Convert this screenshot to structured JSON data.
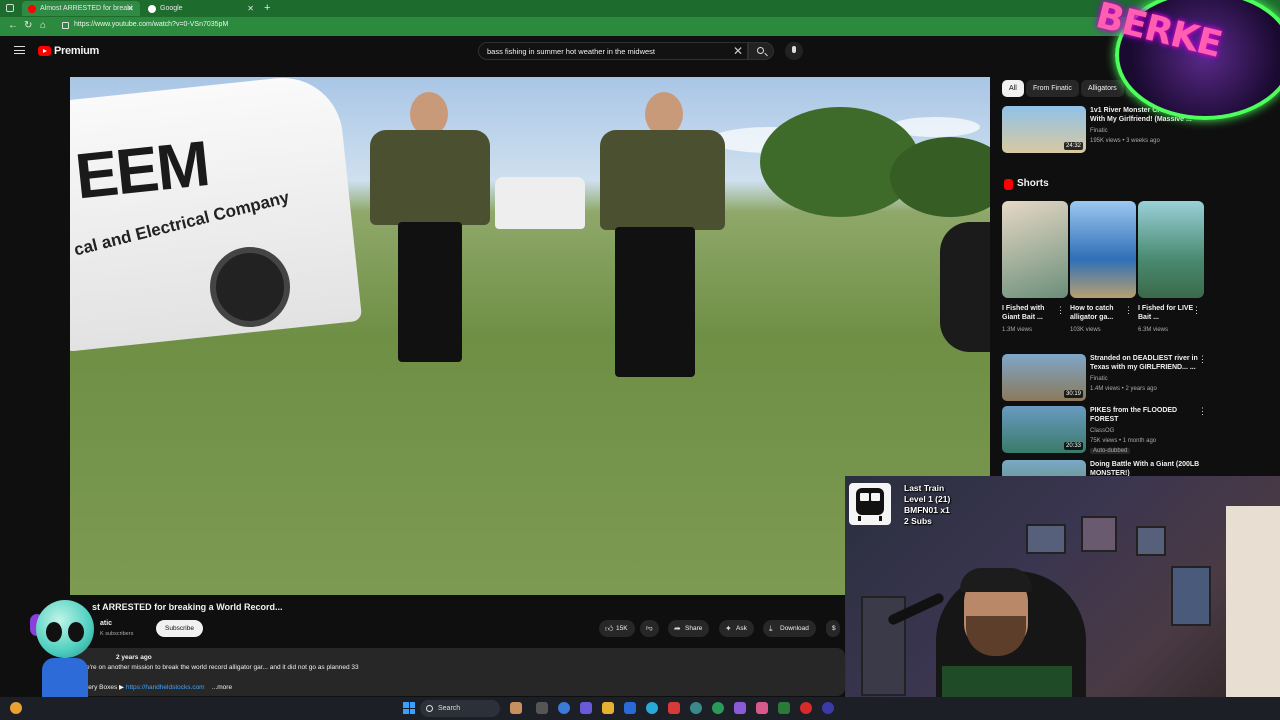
{
  "browser": {
    "tabs": [
      {
        "label": "Almost ARRESTED for breaki",
        "active": true
      },
      {
        "label": "Google",
        "active": false
      }
    ],
    "url": "https://www.youtube.com/watch?v=0-VSn7035pM"
  },
  "header": {
    "brand": "Premium",
    "search_value": "bass fishing in summer hot weather in the midwest"
  },
  "video": {
    "van_logo": "EEM",
    "van_sub": "cal and Electrical Company",
    "title": "st ARRESTED for breaking a World Record...",
    "channel": "atic",
    "subs": "K subscribers",
    "subscribe": "Subscribe",
    "actions": {
      "like": "15K",
      "share": "Share",
      "ask": "Ask",
      "download": "Download"
    },
    "description": {
      "meta": "2 years ago",
      "line": "We're on another mission to break the world record alligator gar... and it did not go as planned 33",
      "links_prefix": "ystery Boxes ▶",
      "link": "https://handheldstocks.com",
      "more": "...more"
    }
  },
  "sidebar": {
    "chips": [
      "All",
      "From Finatic",
      "Alligators",
      "Rece"
    ],
    "top_rec": {
      "title": "1v1 River Monster CHALLENGE With My Girlfriend! (Massive ...",
      "channel": "Finatic",
      "meta": "195K views • 3 weeks ago",
      "duration": "24:32"
    },
    "shorts_label": "Shorts",
    "shorts": [
      {
        "title": "I Fished with Giant Bait ...",
        "views": "1.3M views"
      },
      {
        "title": "How to catch alligator ga...",
        "views": "103K views"
      },
      {
        "title": "I Fished for LIVE Bait ...",
        "views": "6.3M views"
      }
    ],
    "recs": [
      {
        "title": "Stranded on DEADLIEST river in Texas with my GIRLFRIEND... ...",
        "channel": "Finatic",
        "meta": "1.4M views • 2 years ago",
        "duration": "30:19"
      },
      {
        "title": "PIKES from the FLOODED FOREST",
        "channel": "ClassOG",
        "meta": "75K views • 1 month ago",
        "badge": "Auto-dubbed",
        "duration": "20:33"
      },
      {
        "title": "Doing Battle With a Giant (200LB MONSTER!)",
        "channel": "",
        "meta": "",
        "duration": ""
      }
    ]
  },
  "overlay": {
    "train": [
      "Last Train",
      "Level 1  (21)",
      "BMFN01 x1",
      "2 Subs"
    ],
    "logo_text": "BERKE"
  },
  "taskbar": {
    "search": "Search"
  },
  "colors": {
    "accent": "#ff0000",
    "browser_green": "#2b8a3e",
    "link": "#3ea6ff"
  }
}
